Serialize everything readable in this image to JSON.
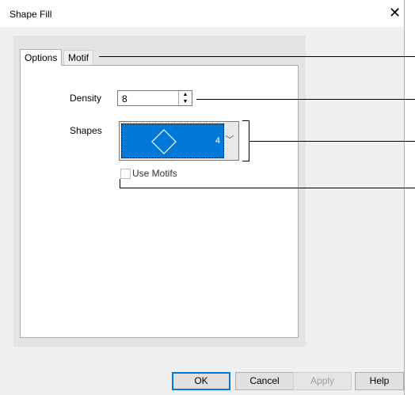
{
  "dialog": {
    "title": "Shape Fill",
    "close_glyph": "✕"
  },
  "tabs": [
    {
      "label": "Options",
      "active": true
    },
    {
      "label": "Motif",
      "active": false
    }
  ],
  "options": {
    "density_label": "Density",
    "density_value": "8",
    "shapes_label": "Shapes",
    "shapes_selected_icon": "diamond-icon",
    "shapes_selected_number": "4",
    "use_motifs_label": "Use Motifs",
    "use_motifs_checked": false,
    "use_motifs_enabled": false
  },
  "buttons": {
    "ok": "OK",
    "cancel": "Cancel",
    "apply": "Apply",
    "help": "Help"
  },
  "colors": {
    "selection": "#0078d7",
    "dialog_bg": "#f0f0f0"
  }
}
